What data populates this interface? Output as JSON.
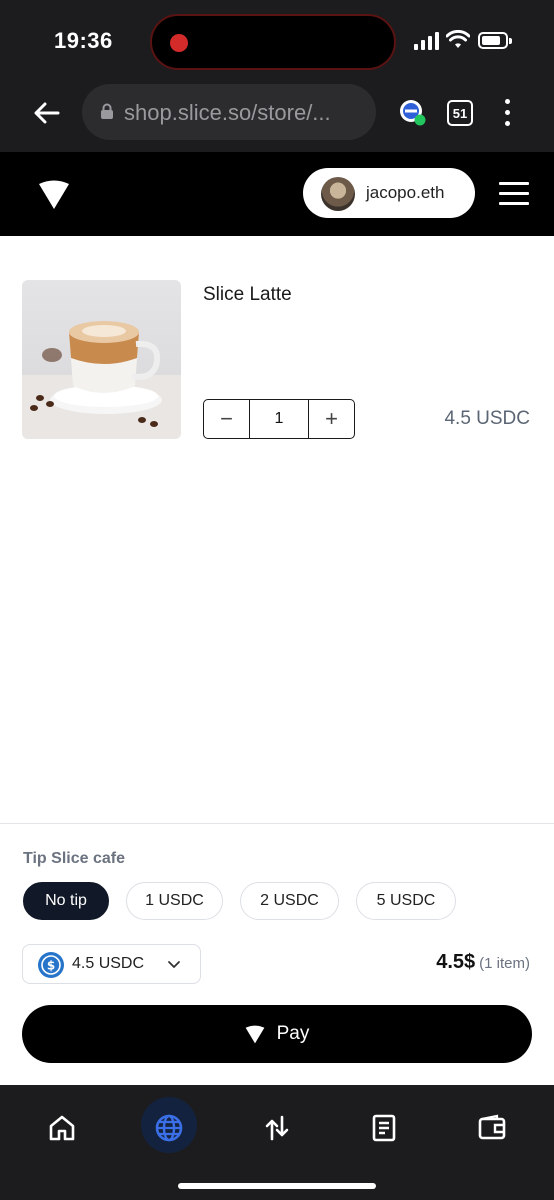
{
  "status_bar": {
    "time": "19:36"
  },
  "browser": {
    "url": "shop.slice.so/store/...",
    "tab_count": "51"
  },
  "header": {
    "username": "jacopo.eth"
  },
  "product": {
    "name": "Slice Latte",
    "quantity": "1",
    "price": "4.5 USDC",
    "decrement_label": "−",
    "increment_label": "+"
  },
  "checkout": {
    "tip_title": "Tip Slice cafe",
    "tips": [
      "No tip",
      "1 USDC",
      "2 USDC",
      "5 USDC"
    ],
    "selected_tip": "No tip",
    "currency_amount": "4.5 USDC",
    "total_amount": "4.5$",
    "total_items": "(1 item)",
    "pay_label": "Pay"
  },
  "bottom_nav": [
    "home-icon",
    "globe-icon",
    "swap-icon",
    "document-icon",
    "wallet-icon"
  ],
  "colors": {
    "usdc": "#2775ca",
    "active_nav": "#3b6fe8",
    "dark": "#111827"
  }
}
